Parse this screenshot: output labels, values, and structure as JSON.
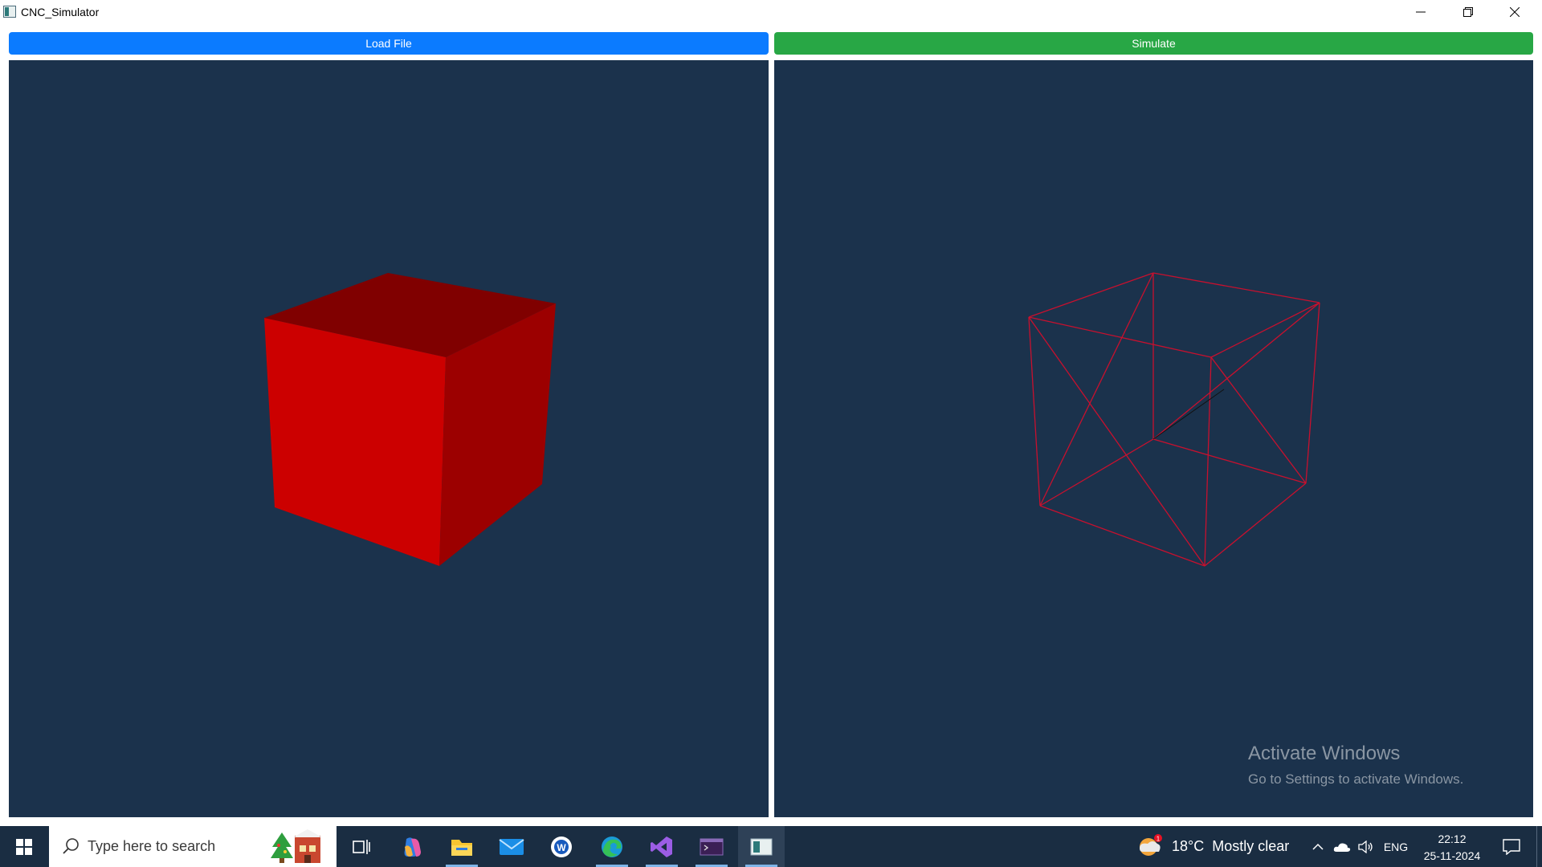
{
  "window": {
    "title": "CNC_Simulator",
    "controls": [
      "minimize-icon",
      "restore-icon",
      "close-icon"
    ]
  },
  "toolbar": {
    "load_label": "Load File",
    "simulate_label": "Simulate"
  },
  "colors": {
    "load_button": "#0b7bff",
    "simulate_button": "#28a745",
    "viewport_bg": "#1b324c",
    "model": "#cc0000"
  },
  "viewports": {
    "left": "solid-red-cube",
    "right": "red-wireframe-cube"
  },
  "watermark": {
    "title": "Activate Windows",
    "subtitle": "Go to Settings to activate Windows."
  },
  "taskbar": {
    "search_placeholder": "Type here to search",
    "apps": [
      "task-view-icon",
      "copilot-icon",
      "file-explorer-icon",
      "mail-icon",
      "word-icon",
      "edge-icon",
      "visual-studio-icon",
      "terminal-icon",
      "cnc-simulator-icon"
    ],
    "weather": "18°C  Mostly clear",
    "weather_badge": "1",
    "language": "ENG",
    "time": "22:12",
    "date": "25-11-2024"
  }
}
